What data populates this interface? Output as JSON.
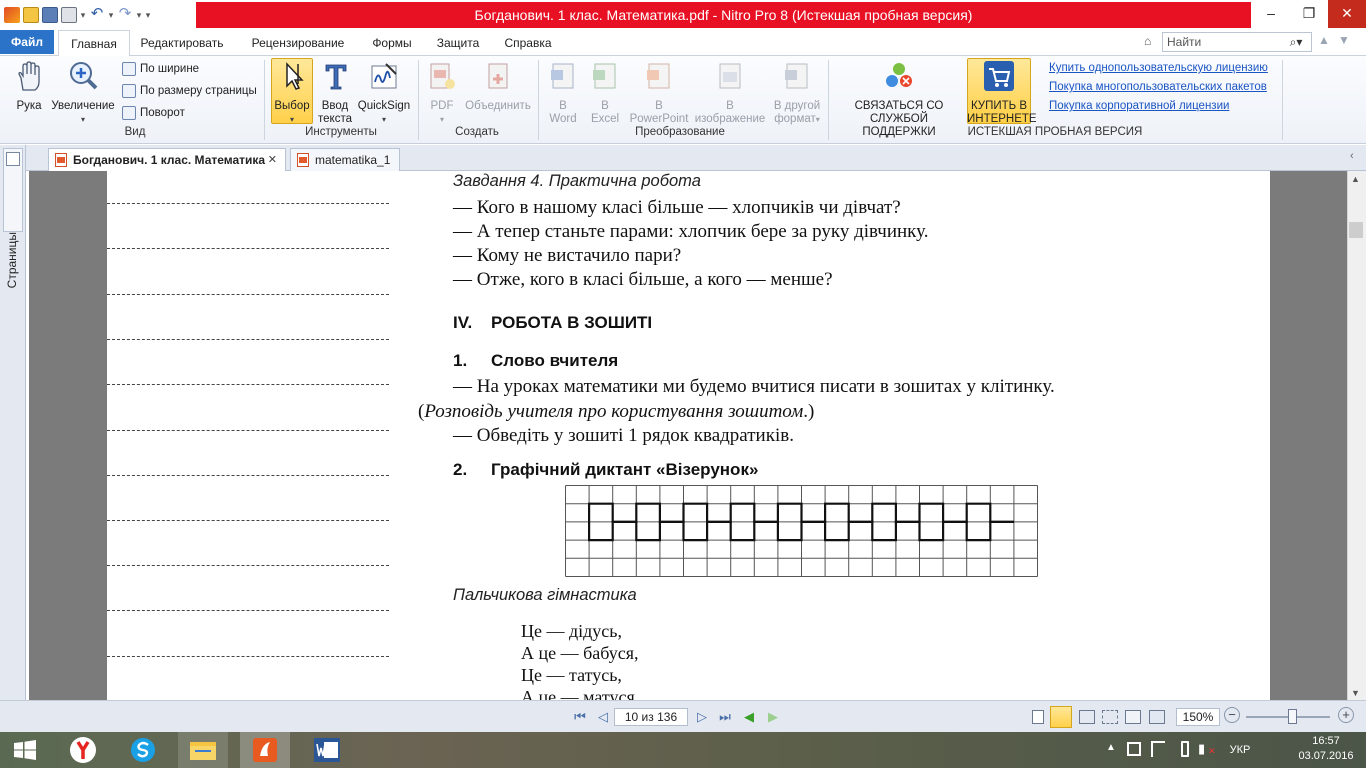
{
  "window": {
    "title": "Богданович. 1 клас. Математика.pdf - Nitro Pro 8 (Истекшая пробная версия)",
    "minimize": "–",
    "maximize": "❐",
    "close": "✕"
  },
  "ribbon_tabs": [
    "Файл",
    "Главная",
    "Редактировать",
    "Рецензирование",
    "Формы",
    "Защита",
    "Справка"
  ],
  "find_placeholder": "Найти",
  "groups": {
    "view": {
      "label": "Вид",
      "hand": "Рука",
      "zoom": "Увеличение",
      "fit_width": "По ширине",
      "fit_page": "По размеру страницы",
      "rotate": "Поворот"
    },
    "tools": {
      "label": "Инструменты",
      "select": "Выбор",
      "type_text_1": "Ввод",
      "type_text_2": "текста",
      "quicksign": "QuickSign"
    },
    "create": {
      "label": "Создать",
      "pdf": "PDF",
      "combine": "Объединить"
    },
    "convert": {
      "label": "Преобразование",
      "word_1": "В",
      "word_2": "Word",
      "excel_1": "В",
      "excel_2": "Excel",
      "ppt_1": "В",
      "ppt_2": "PowerPoint",
      "image_1": "В",
      "image_2": "изображение",
      "other_1": "В другой",
      "other_2": "формат"
    },
    "trial": {
      "label": "ИСТЕКШАЯ ПРОБНАЯ ВЕРСИЯ",
      "support_1": "СВЯЗАТЬСЯ СО",
      "support_2": "СЛУЖБОЙ ПОДДЕРЖКИ",
      "buy_1": "КУПИТЬ В",
      "buy_2": "ИНТЕРНЕТЕ",
      "link_single": "Купить однопользовательскую лицензию",
      "link_multi": "Покупка многопользовательских пакетов",
      "link_corp": "Покупка корпоративной лицензии"
    }
  },
  "doc_tabs": [
    {
      "label": "Богданович. 1 клас. Математика",
      "close": "✕"
    },
    {
      "label": "matematika_1"
    }
  ],
  "side_panel_label": "Страницы",
  "document": {
    "task4": "Завдання 4. Практична робота",
    "q1": "— Кого в нашому класі більше — хлопчиків чи дівчат?",
    "q2": "— А тепер станьте парами: хлопчик бере за руку дівчинку.",
    "q3": "— Кому не вистачило пари?",
    "q4": "— Отже, кого в класі більше, а кого — менше?",
    "sec4_num": "IV.",
    "sec4_title": "РОБОТА В ЗОШИТІ",
    "s1_num": "1.",
    "s1_title": "Слово вчителя",
    "p1": "— На уроках математики ми будемо вчитися писати в зошитах у клітинку.",
    "p2_open": "(",
    "p2_ital": "Розповідь учителя про користування зошитом",
    "p2_close": ".)",
    "p3": "— Обведіть у зошиті 1 рядок квадратиків.",
    "s2_num": "2.",
    "s2_title": "Графічний диктант «Візерунок»",
    "gym": "Пальчикова гімнастика",
    "poem": [
      "Це — дідусь,",
      "А це — бабуся,",
      "Це — татусь,",
      "А це — матуся,"
    ]
  },
  "status": {
    "page_indicator": "10 из 136",
    "zoom": "150%"
  },
  "taskbar": {
    "lang": "УКР",
    "time": "16:57",
    "date": "03.07.2016"
  },
  "colors": {
    "file_tab": "#2b72c9",
    "title_bar": "#e81123",
    "selected_tool": "#ffd04a",
    "link": "#1a55c4"
  }
}
